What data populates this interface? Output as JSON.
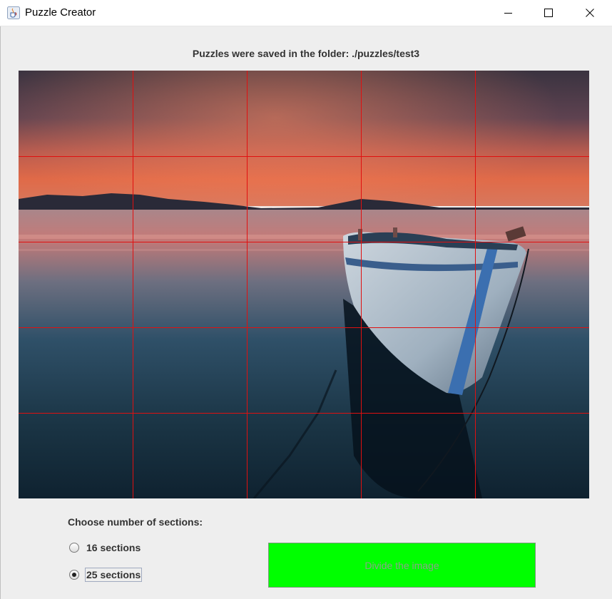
{
  "window": {
    "title": "Puzzle Creator",
    "controls": {
      "minimize": "minimize",
      "maximize": "maximize",
      "close": "close"
    }
  },
  "status_message": "Puzzles were saved in the folder: ./puzzles/test3",
  "image": {
    "description_icon": "sunset-boat-photo",
    "grid_color": "#ff0000",
    "grid_divisions": 5
  },
  "sections": {
    "prompt": "Choose number of sections:",
    "options": [
      {
        "label": "16 sections",
        "selected": false
      },
      {
        "label": "25 sections",
        "selected": true
      }
    ]
  },
  "divide_button": {
    "label": "Divide the image",
    "color": "#00ff00"
  }
}
